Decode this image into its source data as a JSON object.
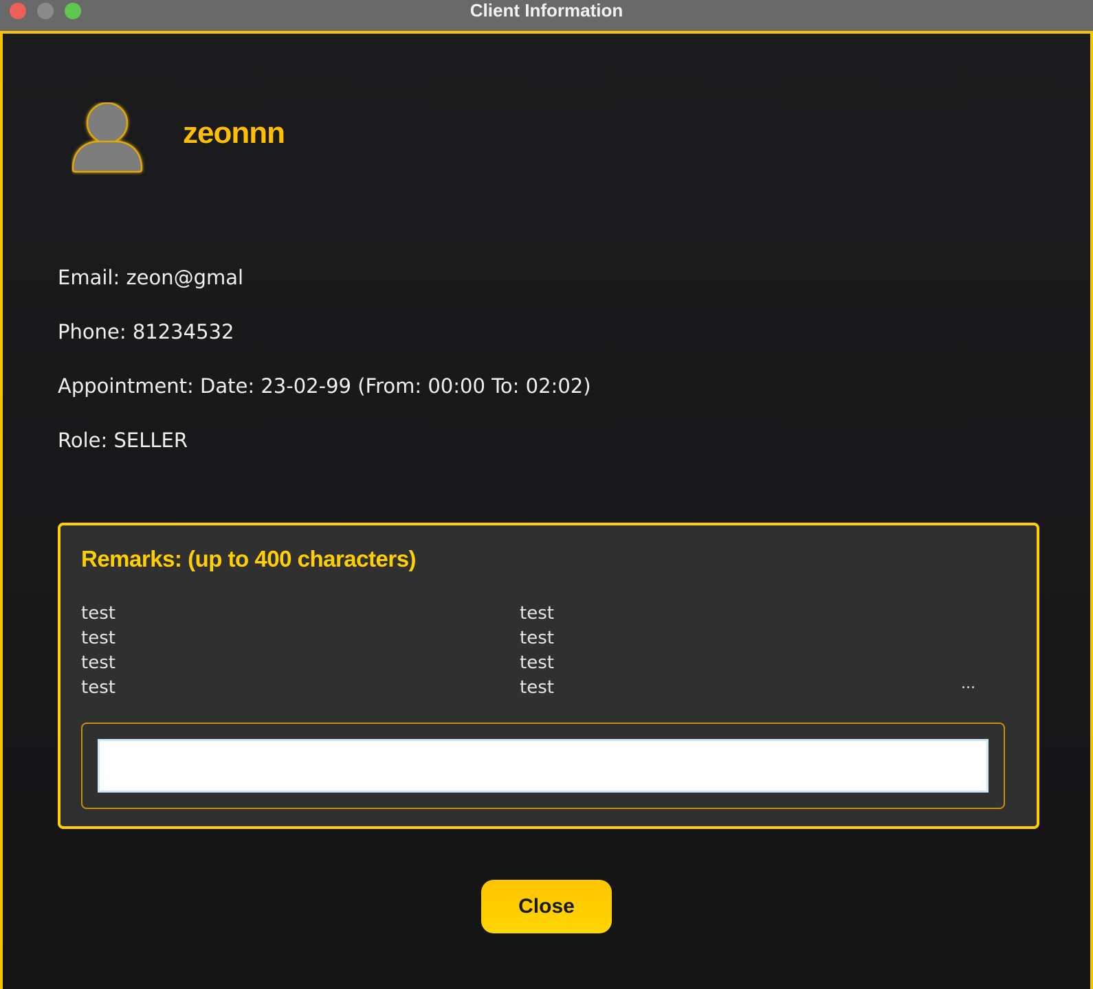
{
  "window": {
    "title": "Client Information",
    "controls": {
      "close_color": "#ee5f58",
      "minimize_color": "#8a8a8a",
      "maximize_color": "#5fc64e"
    }
  },
  "client": {
    "name": "zeonnn",
    "email_line": "Email: zeon@gmal",
    "phone_line": "Phone: 81234532",
    "appointment_line": "Appointment: Date: 23-02-99 (From: 00:00 To: 02:02)",
    "role_line": "Role: SELLER"
  },
  "remarks": {
    "title": "Remarks: (up to 400 characters)",
    "items": [
      "test",
      "test",
      "test",
      "test",
      "test",
      "test",
      "test",
      "test"
    ],
    "overflow_indicator": "...",
    "input_value": "",
    "input_placeholder": ""
  },
  "actions": {
    "close_label": "Close"
  },
  "colors": {
    "accent": "#ffd000",
    "name_accent": "#ffbf00",
    "background": "#1a1a1c",
    "panel": "#303030"
  },
  "icons": {
    "avatar": "user-silhouette-icon"
  }
}
